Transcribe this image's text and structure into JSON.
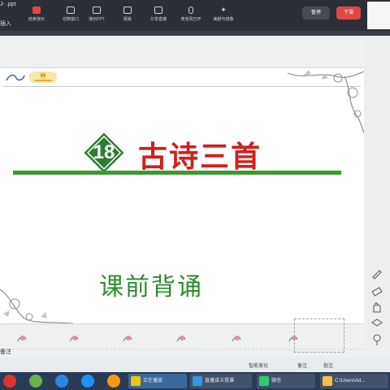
{
  "window": {
    "title_fragment": "J- .ppt",
    "secondary_fragment": "插入"
  },
  "toolbar": {
    "buttons": [
      {
        "label": "结束演示",
        "icon": "record-icon"
      },
      {
        "label": "切换窗口",
        "icon": "window-switch-icon"
      },
      {
        "label": "演示PPT",
        "icon": "ppt-icon"
      },
      {
        "label": "题板",
        "icon": "board-icon"
      },
      {
        "label": "分享直播",
        "icon": "share-icon"
      },
      {
        "label": "麦克风已开",
        "icon": "microphone-icon"
      },
      {
        "label": "美颜与镜像",
        "icon": "sparkle-icon"
      }
    ],
    "pill_gray": "暂停",
    "pill_red": "下课"
  },
  "slide": {
    "badge_number": "18",
    "title": "古诗三首",
    "subtitle": "课前背诵"
  },
  "notes": {
    "label": "备注"
  },
  "status": {
    "smart_beautify": "智能美化",
    "notes_toggle": "备注",
    "comment": "批注"
  },
  "taskbar": {
    "tasks": [
      {
        "label": "正在播放"
      },
      {
        "label": "直播讲义授课"
      },
      {
        "label": "微信"
      },
      {
        "label": "C:\\Users\\Ad..."
      }
    ]
  },
  "colors": {
    "title_red": "#d01f1f",
    "green": "#3a9a2c",
    "badge_green": "#2e7d32",
    "end_button_red": "#e04848"
  }
}
